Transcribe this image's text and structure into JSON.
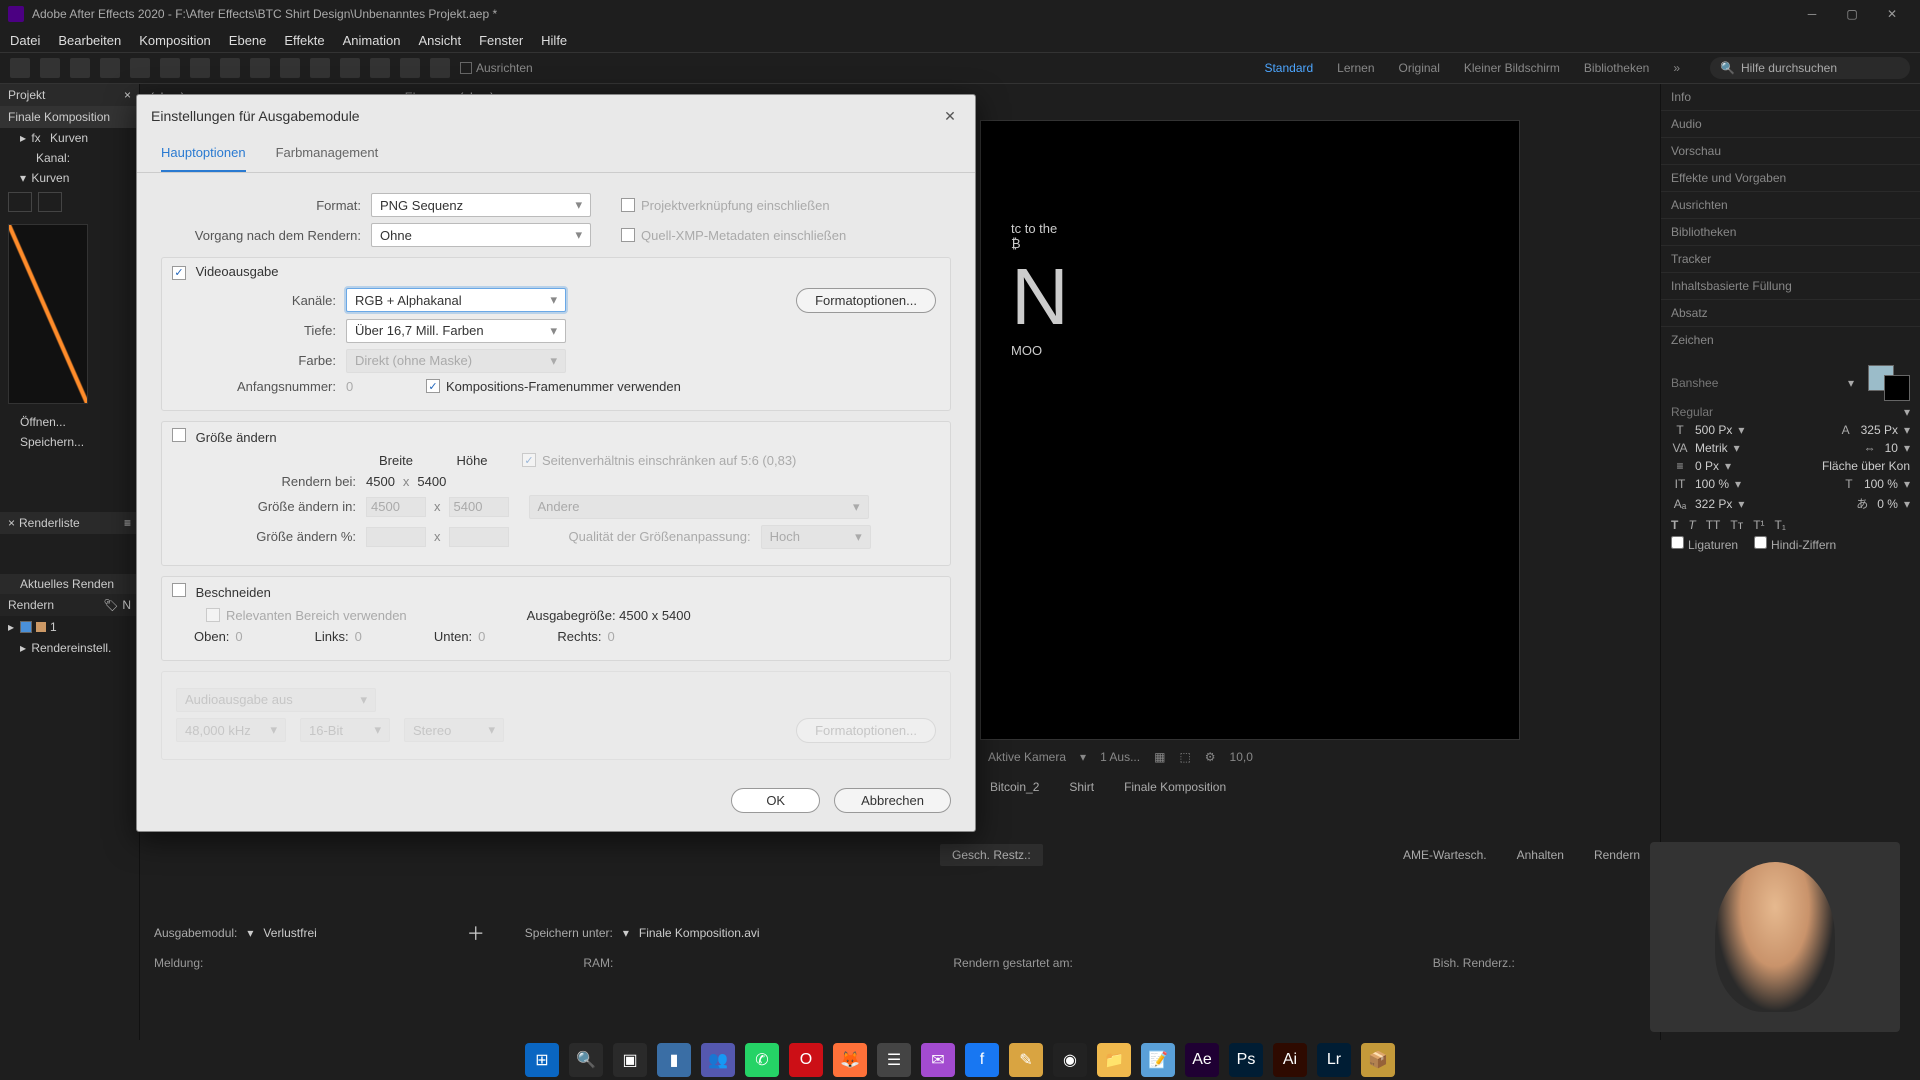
{
  "titlebar": {
    "text": "Adobe After Effects 2020 - F:\\After Effects\\BTC Shirt Design\\Unbenanntes Projekt.aep *"
  },
  "menu": [
    "Datei",
    "Bearbeiten",
    "Komposition",
    "Ebene",
    "Effekte",
    "Animation",
    "Ansicht",
    "Fenster",
    "Hilfe"
  ],
  "toolbar": {
    "ausrichten": "Ausrichten",
    "workspaces": [
      "Standard",
      "Lernen",
      "Original",
      "Kleiner Bildschirm",
      "Bibliotheken"
    ],
    "active_ws": "Standard",
    "search_placeholder": "Hilfe durchsuchen"
  },
  "left_panel": {
    "projekt_tab": "Projekt",
    "comp_header": "Finale Komposition",
    "fx": "fx",
    "kurven": "Kurven",
    "kanal": "Kanal:",
    "kurven2": "Kurven",
    "offnen": "Öffnen...",
    "speichern": "Speichern...",
    "renderliste": "Renderliste",
    "aktuelles_rendern": "Aktuelles Renden",
    "rendern": "Rendern",
    "n": "N",
    "one": "1",
    "rendereinstell": "Rendereinstell."
  },
  "preview_strip": {
    "ebene": "Ebene",
    "none": "(ohne)"
  },
  "preview_controls": {
    "aktive_kamera": "Aktive Kamera",
    "one_aus": "1 Aus...",
    "zoom": "10,0"
  },
  "comp_tabs": [
    "Bitcoin_2",
    "Shirt",
    "Finale Komposition"
  ],
  "right_panels": {
    "info": "Info",
    "audio": "Audio",
    "vorschau": "Vorschau",
    "effekte": "Effekte und Vorgaben",
    "ausrichten": "Ausrichten",
    "bibliotheken": "Bibliotheken",
    "tracker": "Tracker",
    "inhalt": "Inhaltsbasierte Füllung",
    "absatz": "Absatz",
    "zeichen": "Zeichen"
  },
  "char_panel": {
    "font": "Banshee",
    "style": "Regular",
    "size": "500 Px",
    "leading": "325 Px",
    "va": "Metrik",
    "tracking": "10",
    "stroke": "0 Px",
    "fill_over": "Fläche über Kon",
    "hscale": "100 %",
    "vscale": "100 %",
    "baseline": "322 Px",
    "tsume": "0 %",
    "ligaturen": "Ligaturen",
    "hindi": "Hindi-Ziffern"
  },
  "render_queue": {
    "ausgabemodul": "Ausgabemodul:",
    "verlustfrei": "Verlustfrei",
    "speichern_unter": "Speichern unter:",
    "file": "Finale Komposition.avi",
    "gesch": "Gesch. Restz.:",
    "ame": "AME-Wartesch.",
    "anhalten": "Anhalten",
    "rendern_btn": "Rendern",
    "meldung": "Meldung:",
    "ram": "RAM:",
    "rendern_gestartet": "Rendern gestartet am:",
    "bish": "Bish. Renderz.:"
  },
  "dialog": {
    "title": "Einstellungen für Ausgabemodule",
    "tabs": {
      "haupt": "Hauptoptionen",
      "farb": "Farbmanagement"
    },
    "format_lbl": "Format:",
    "format_val": "PNG Sequenz",
    "vorgang_lbl": "Vorgang nach dem Rendern:",
    "vorgang_val": "Ohne",
    "projekt_chk": "Projektverknüpfung einschließen",
    "xmp_chk": "Quell-XMP-Metadaten einschließen",
    "video_chk": "Videoausgabe",
    "kanale_lbl": "Kanäle:",
    "kanale_val": "RGB + Alphakanal",
    "tiefe_lbl": "Tiefe:",
    "tiefe_val": "Über 16,7 Mill. Farben",
    "farbe_lbl": "Farbe:",
    "farbe_val": "Direkt (ohne Maske)",
    "anfangs_lbl": "Anfangsnummer:",
    "anfangs_val": "0",
    "kompframe": "Kompositions-Framenummer verwenden",
    "formatopt": "Formatoptionen...",
    "groesse": "Größe ändern",
    "breite": "Breite",
    "hoehe": "Höhe",
    "seitenverh": "Seitenverhältnis einschränken auf 5:6 (0,83)",
    "rendern_bei": "Rendern bei:",
    "rb_w": "4500",
    "rb_h": "5400",
    "groesse_in": "Größe ändern in:",
    "gi_w": "4500",
    "gi_h": "5400",
    "andere": "Andere",
    "groesse_pct": "Größe ändern %:",
    "qual": "Qualität der Größenanpassung:",
    "qual_val": "Hoch",
    "beschneiden": "Beschneiden",
    "relevant": "Relevanten Bereich verwenden",
    "ausgabegroesse": "Ausgabegröße: 4500 x 5400",
    "oben": "Oben:",
    "oben_v": "0",
    "links": "Links:",
    "links_v": "0",
    "unten": "Unten:",
    "unten_v": "0",
    "rechts": "Rechts:",
    "rechts_v": "0",
    "audio_aus": "Audioausgabe aus",
    "khz": "48,000 kHz",
    "bit": "16-Bit",
    "stereo": "Stereo",
    "formatopt2": "Formatoptionen...",
    "ok": "OK",
    "abbrechen": "Abbrechen"
  },
  "taskbar_icons": [
    {
      "name": "windows",
      "bg": "#0a66c2",
      "glyph": "⊞"
    },
    {
      "name": "search",
      "bg": "#2a2a2a",
      "glyph": "🔍"
    },
    {
      "name": "taskview",
      "bg": "#2a2a2a",
      "glyph": "▣"
    },
    {
      "name": "widgets",
      "bg": "#3a6ea5",
      "glyph": "▮"
    },
    {
      "name": "teams",
      "bg": "#5558af",
      "glyph": "👥"
    },
    {
      "name": "whatsapp",
      "bg": "#25d366",
      "glyph": "✆"
    },
    {
      "name": "opera",
      "bg": "#cc0f16",
      "glyph": "O"
    },
    {
      "name": "firefox",
      "bg": "#ff7139",
      "glyph": "🦊"
    },
    {
      "name": "utility",
      "bg": "#444",
      "glyph": "☰"
    },
    {
      "name": "messenger",
      "bg": "#a34bd0",
      "glyph": "✉"
    },
    {
      "name": "facebook",
      "bg": "#1877f2",
      "glyph": "f"
    },
    {
      "name": "notes",
      "bg": "#d9a441",
      "glyph": "✎"
    },
    {
      "name": "obs",
      "bg": "#222",
      "glyph": "◉"
    },
    {
      "name": "files",
      "bg": "#f0b94d",
      "glyph": "📁"
    },
    {
      "name": "notepad",
      "bg": "#5aa0d8",
      "glyph": "📝"
    },
    {
      "name": "ae",
      "bg": "#1f0033",
      "glyph": "Ae"
    },
    {
      "name": "ps",
      "bg": "#001d34",
      "glyph": "Ps"
    },
    {
      "name": "ai",
      "bg": "#2e0a00",
      "glyph": "Ai"
    },
    {
      "name": "lr",
      "bg": "#001d34",
      "glyph": "Lr"
    },
    {
      "name": "folder2",
      "bg": "#c49a3a",
      "glyph": "📦"
    }
  ]
}
